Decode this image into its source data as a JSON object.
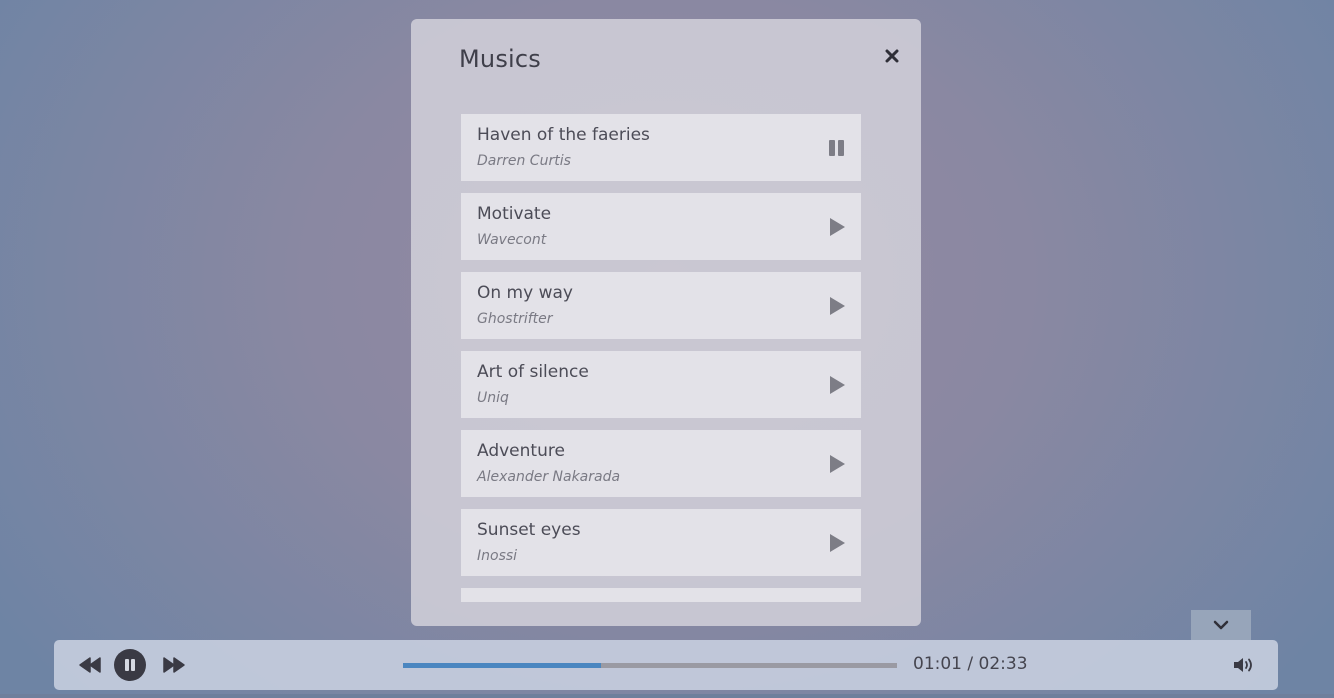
{
  "modal": {
    "title": "Musics",
    "close_icon": "close-icon",
    "tracks": [
      {
        "title": "Haven of the faeries",
        "artist": "Darren Curtis",
        "state": "playing",
        "icon": "pause-icon"
      },
      {
        "title": "Motivate",
        "artist": "Wavecont",
        "state": "stopped",
        "icon": "play-icon"
      },
      {
        "title": "On my way",
        "artist": "Ghostrifter",
        "state": "stopped",
        "icon": "play-icon"
      },
      {
        "title": "Art of silence",
        "artist": "Uniq",
        "state": "stopped",
        "icon": "play-icon"
      },
      {
        "title": "Adventure",
        "artist": "Alexander Nakarada",
        "state": "stopped",
        "icon": "play-icon"
      },
      {
        "title": "Sunset eyes",
        "artist": "Inossi",
        "state": "stopped",
        "icon": "play-icon"
      }
    ]
  },
  "player": {
    "current_time": "01:01",
    "separator": "/",
    "duration": "02:33",
    "progress_fraction": 0.4,
    "rewind_icon": "rewind-icon",
    "pause_icon": "pause-icon",
    "forward_icon": "fast-forward-icon",
    "volume_icon": "volume-icon",
    "collapse_icon": "chevron-down-icon"
  },
  "colors": {
    "accent": "#4a86c0",
    "control_dark": "#3a3a44"
  }
}
